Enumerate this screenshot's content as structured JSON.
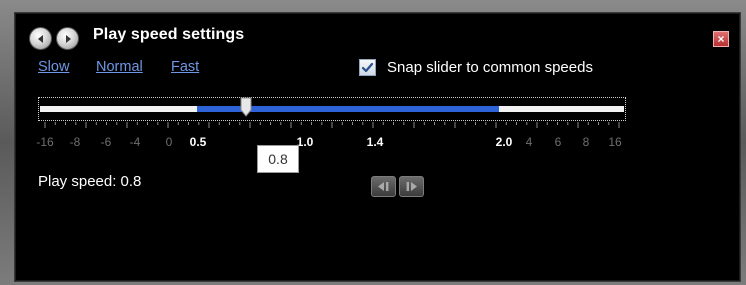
{
  "window": {
    "title": "Play speed settings",
    "close_glyph": "×"
  },
  "presets": {
    "slow": "Slow",
    "normal": "Normal",
    "fast": "Fast"
  },
  "snap": {
    "label": "Snap slider to common speeds",
    "checked": true
  },
  "slider": {
    "tick_labels": [
      {
        "text": "-16",
        "major": false
      },
      {
        "text": "-8",
        "major": false
      },
      {
        "text": "-6",
        "major": false
      },
      {
        "text": "-4",
        "major": false
      },
      {
        "text": "0",
        "major": false
      },
      {
        "text": "0.5",
        "major": true
      },
      {
        "text": "1.0",
        "major": true
      },
      {
        "text": "1.4",
        "major": true
      },
      {
        "text": "2.0",
        "major": true
      },
      {
        "text": "4",
        "major": false
      },
      {
        "text": "6",
        "major": false
      },
      {
        "text": "8",
        "major": false
      },
      {
        "text": "16",
        "major": false
      }
    ],
    "tooltip": "0.8",
    "value": 0.8
  },
  "status": {
    "play_speed": "Play speed: 0.8"
  },
  "icons": {
    "back": "back-arrow-icon",
    "forward": "forward-arrow-icon",
    "close": "close-icon",
    "step_back": "step-back-icon",
    "step_forward": "step-forward-icon"
  },
  "colors": {
    "accent": "#2f63d8",
    "link": "#6f97e6",
    "close": "#c23b3b"
  }
}
